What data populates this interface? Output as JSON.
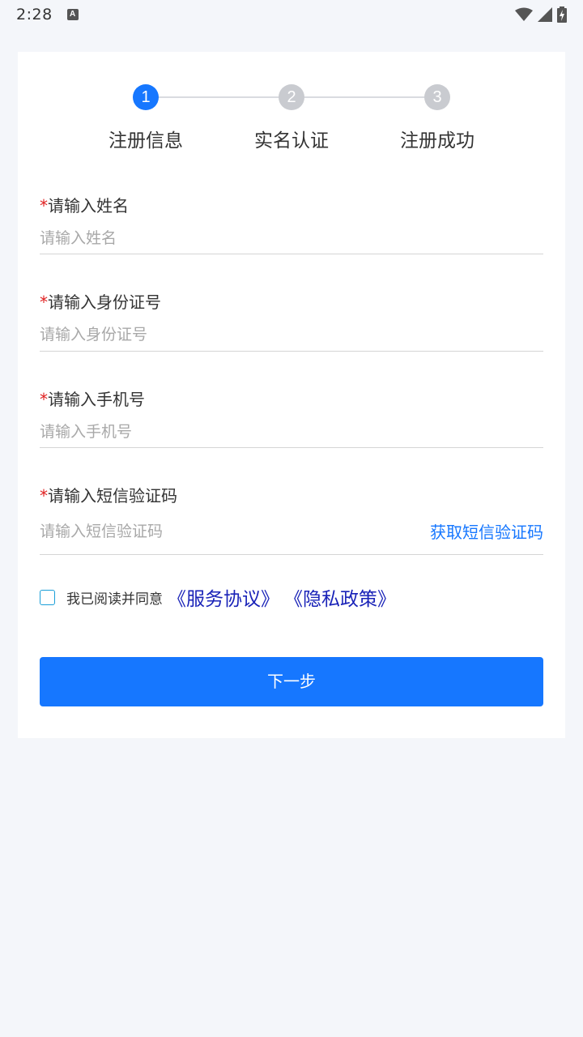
{
  "status_bar": {
    "time": "2:28",
    "notification_icon": "a-notification-icon",
    "icons": [
      "wifi-icon",
      "signal-icon",
      "battery-charging-icon"
    ]
  },
  "stepper": {
    "steps": [
      {
        "number": "1",
        "label": "注册信息",
        "state": "active"
      },
      {
        "number": "2",
        "label": "实名认证",
        "state": "inactive"
      },
      {
        "number": "3",
        "label": "注册成功",
        "state": "inactive"
      }
    ]
  },
  "form": {
    "required_mark": "*",
    "name": {
      "label": "请输入姓名",
      "placeholder": "请输入姓名",
      "value": ""
    },
    "id_number": {
      "label": "请输入身份证号",
      "placeholder": "请输入身份证号",
      "value": ""
    },
    "phone": {
      "label": "请输入手机号",
      "placeholder": "请输入手机号",
      "value": ""
    },
    "sms_code": {
      "label": "请输入短信验证码",
      "placeholder": "请输入短信验证码",
      "value": "",
      "get_code_label": "获取短信验证码"
    }
  },
  "agreement": {
    "checked": false,
    "text": "我已阅读并同意",
    "service_link": "《服务协议》",
    "privacy_link": "《隐私政策》"
  },
  "next_button": {
    "label": "下一步"
  },
  "colors": {
    "primary": "#1677ff",
    "required": "#e02020",
    "link_dark": "#1a23b8",
    "background": "#f4f6fa"
  }
}
